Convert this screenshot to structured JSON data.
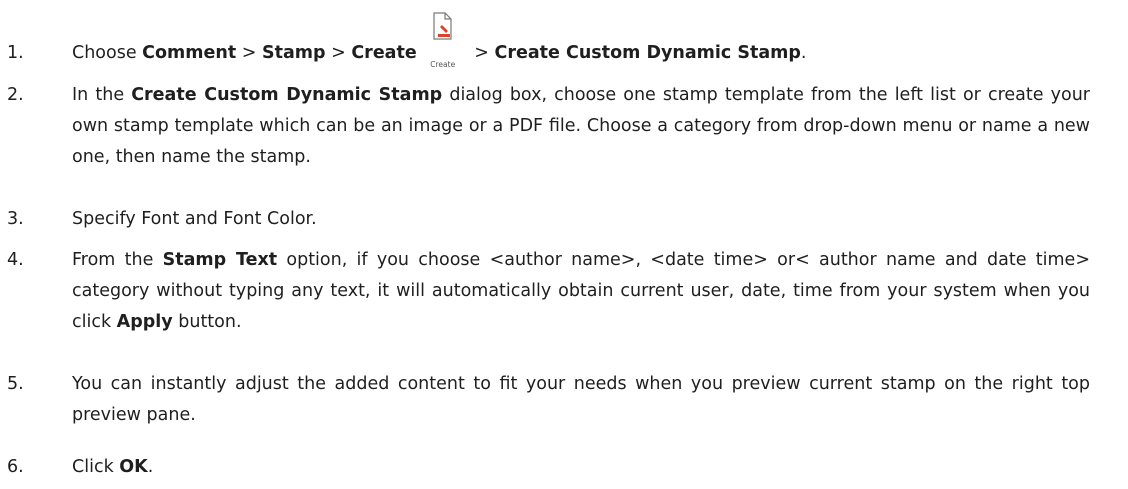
{
  "steps": [
    {
      "number": "1.",
      "parts": {
        "t1": "Choose ",
        "b1": "Comment",
        "t2": " > ",
        "b2": "Stamp",
        "t3": " > ",
        "b3": "Create",
        "icon_name": "create-stamp-icon",
        "icon_caption": "Create",
        "t4": " > ",
        "b4": "Create Custom Dynamic Stamp",
        "t5": "."
      }
    },
    {
      "number": "2.",
      "parts": {
        "t1": "In the ",
        "b1": "Create Custom Dynamic Stamp",
        "t2": " dialog box, choose one stamp template from the left list or create your own stamp template which can be an image or a PDF file. Choose a category from drop-down menu or name a new one, then name the stamp."
      }
    },
    {
      "number": "3.",
      "parts": {
        "t1": "Specify Font and Font Color."
      }
    },
    {
      "number": "4.",
      "parts": {
        "t1": "From the ",
        "b1": "Stamp Text",
        "t2": " option, if you choose <author name>, <date time> or< author name and date time> category without typing any text, it will automatically obtain current user, date, time from your system when you click ",
        "b2": "Apply",
        "t3": " button."
      }
    },
    {
      "number": "5.",
      "parts": {
        "t1": "You can instantly adjust the added content to fit your needs when you preview current stamp on the right top preview pane."
      }
    },
    {
      "number": "6.",
      "parts": {
        "t1": "Click ",
        "b1": "OK",
        "t2": "."
      }
    }
  ],
  "colors": {
    "text": "#1f1f1f",
    "icon_accent": "#d9432c",
    "icon_outline": "#7a7a7a"
  }
}
